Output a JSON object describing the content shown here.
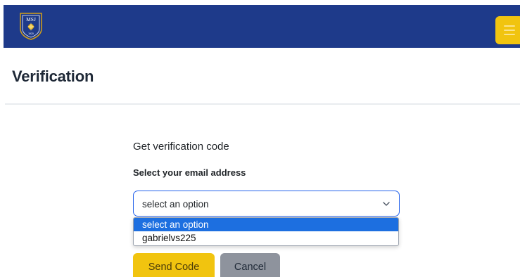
{
  "header": {
    "logo_icon": "school-crest-logo",
    "logo_text_top": "MSJ",
    "logo_text_bottom": "1920",
    "menu_icon": "hamburger-menu-icon",
    "colors": {
      "navbar": "#1e3a8a",
      "accent": "#f1c40f"
    }
  },
  "page": {
    "title": "Verification"
  },
  "form": {
    "heading": "Get verification code",
    "email_label": "Select your email address",
    "select": {
      "value": "select an option",
      "icon": "chevron-down-icon",
      "options": [
        {
          "label": "select an option",
          "selected": true
        },
        {
          "label": "gabrielvs225",
          "selected": false
        }
      ]
    },
    "send_label": "Send Code",
    "cancel_label": "Cancel"
  }
}
